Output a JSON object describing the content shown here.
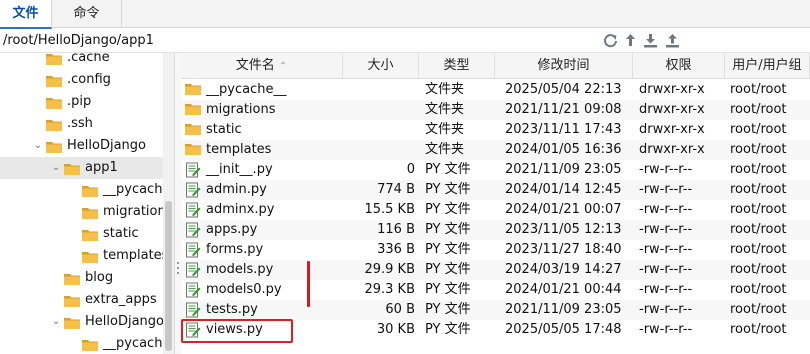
{
  "tabs": [
    {
      "label": "文件",
      "active": true
    },
    {
      "label": "命令",
      "active": false
    }
  ],
  "path": "/root/HelloDjango/app1",
  "toolbar_icons": [
    "refresh-icon",
    "upload-arrow-icon",
    "download-icon",
    "upload-icon"
  ],
  "tree": {
    "items": [
      {
        "label": ".cache",
        "depth": 1,
        "expanded": null,
        "selected": false
      },
      {
        "label": ".config",
        "depth": 1,
        "expanded": null,
        "selected": false
      },
      {
        "label": ".pip",
        "depth": 1,
        "expanded": null,
        "selected": false
      },
      {
        "label": ".ssh",
        "depth": 1,
        "expanded": null,
        "selected": false
      },
      {
        "label": "HelloDjango",
        "depth": 1,
        "expanded": true,
        "selected": false
      },
      {
        "label": "app1",
        "depth": 2,
        "expanded": true,
        "selected": true
      },
      {
        "label": "__pycache__",
        "depth": 3,
        "expanded": null,
        "selected": false
      },
      {
        "label": "migrations",
        "depth": 3,
        "expanded": null,
        "selected": false
      },
      {
        "label": "static",
        "depth": 3,
        "expanded": null,
        "selected": false
      },
      {
        "label": "templates",
        "depth": 3,
        "expanded": null,
        "selected": false
      },
      {
        "label": "blog",
        "depth": 2,
        "expanded": null,
        "selected": false
      },
      {
        "label": "extra_apps",
        "depth": 2,
        "expanded": null,
        "selected": false
      },
      {
        "label": "HelloDjango",
        "depth": 2,
        "expanded": true,
        "selected": false
      },
      {
        "label": "__pycache__",
        "depth": 3,
        "expanded": null,
        "selected": false
      }
    ]
  },
  "columns": {
    "name": "文件名",
    "size": "大小",
    "type": "类型",
    "mtime": "修改时间",
    "perm": "权限",
    "owner": "用户/用户组"
  },
  "files": [
    {
      "name": "__pycache__",
      "kind": "folder",
      "size": "",
      "type": "文件夹",
      "mtime": "2025/05/04 22:13",
      "perm": "drwxr-xr-x",
      "owner": "root/root"
    },
    {
      "name": "migrations",
      "kind": "folder",
      "size": "",
      "type": "文件夹",
      "mtime": "2021/11/21 09:08",
      "perm": "drwxr-xr-x",
      "owner": "root/root"
    },
    {
      "name": "static",
      "kind": "folder",
      "size": "",
      "type": "文件夹",
      "mtime": "2023/11/11 17:43",
      "perm": "drwxr-xr-x",
      "owner": "root/root"
    },
    {
      "name": "templates",
      "kind": "folder",
      "size": "",
      "type": "文件夹",
      "mtime": "2024/01/05 16:36",
      "perm": "drwxr-xr-x",
      "owner": "root/root"
    },
    {
      "name": "__init__.py",
      "kind": "file",
      "size": "0",
      "type": "PY 文件",
      "mtime": "2021/11/09 23:05",
      "perm": "-rw-r--r--",
      "owner": "root/root"
    },
    {
      "name": "admin.py",
      "kind": "file",
      "size": "774 B",
      "type": "PY 文件",
      "mtime": "2024/01/14 12:45",
      "perm": "-rw-r--r--",
      "owner": "root/root"
    },
    {
      "name": "adminx.py",
      "kind": "file",
      "size": "15.5 KB",
      "type": "PY 文件",
      "mtime": "2024/01/21 00:07",
      "perm": "-rw-r--r--",
      "owner": "root/root"
    },
    {
      "name": "apps.py",
      "kind": "file",
      "size": "116 B",
      "type": "PY 文件",
      "mtime": "2023/11/05 12:13",
      "perm": "-rw-r--r--",
      "owner": "root/root"
    },
    {
      "name": "forms.py",
      "kind": "file",
      "size": "336 B",
      "type": "PY 文件",
      "mtime": "2023/11/27 18:40",
      "perm": "-rw-r--r--",
      "owner": "root/root"
    },
    {
      "name": "models.py",
      "kind": "file",
      "size": "29.9 KB",
      "type": "PY 文件",
      "mtime": "2024/03/19 14:27",
      "perm": "-rw-r--r--",
      "owner": "root/root"
    },
    {
      "name": "models0.py",
      "kind": "file",
      "size": "29.3 KB",
      "type": "PY 文件",
      "mtime": "2024/01/21 00:44",
      "perm": "-rw-r--r--",
      "owner": "root/root"
    },
    {
      "name": "tests.py",
      "kind": "file",
      "size": "60 B",
      "type": "PY 文件",
      "mtime": "2021/11/09 23:05",
      "perm": "-rw-r--r--",
      "owner": "root/root"
    },
    {
      "name": "views.py",
      "kind": "file",
      "size": "30 KB",
      "type": "PY 文件",
      "mtime": "2025/05/05 17:48",
      "perm": "-rw-r--r--",
      "owner": "root/root"
    }
  ],
  "colors": {
    "folder": "#f5c04a",
    "folder_dark": "#d9a02e",
    "tab_active": "#0a4ea3",
    "highlight": "#e02020"
  }
}
